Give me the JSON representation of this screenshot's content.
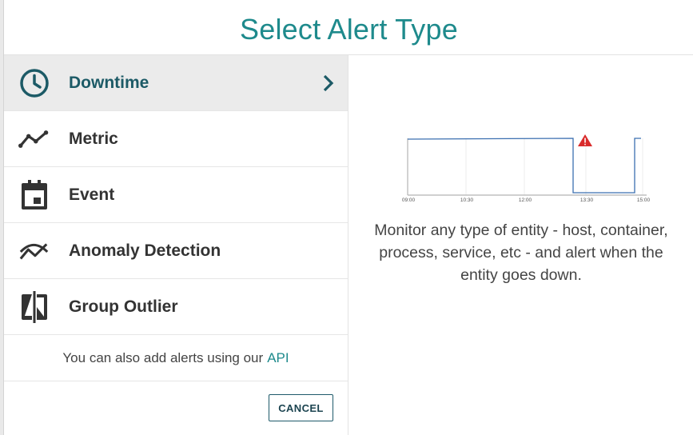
{
  "dialog": {
    "title": "Select Alert Type"
  },
  "alert_types": [
    {
      "label": "Downtime",
      "icon": "clock-icon",
      "selected": true
    },
    {
      "label": "Metric",
      "icon": "line-chart-icon",
      "selected": false
    },
    {
      "label": "Event",
      "icon": "calendar-icon",
      "selected": false
    },
    {
      "label": "Anomaly Detection",
      "icon": "anomaly-icon",
      "selected": false
    },
    {
      "label": "Group Outlier",
      "icon": "compare-icon",
      "selected": false
    }
  ],
  "api_note": {
    "text": "You can also add alerts using our",
    "link": "API"
  },
  "cancel_button": {
    "label": "CANCEL"
  },
  "preview": {
    "x_ticks": [
      "09:00",
      "10:30",
      "12:00",
      "13:30",
      "15:00"
    ],
    "description": "Monitor any type of entity - host, container, process, service, etc - and alert when the entity goes down.",
    "warning_icon": "warning-triangle-icon"
  },
  "colors": {
    "accent": "#1e8a8c",
    "line": "#3b6fb0",
    "warning": "#d92b2b"
  }
}
